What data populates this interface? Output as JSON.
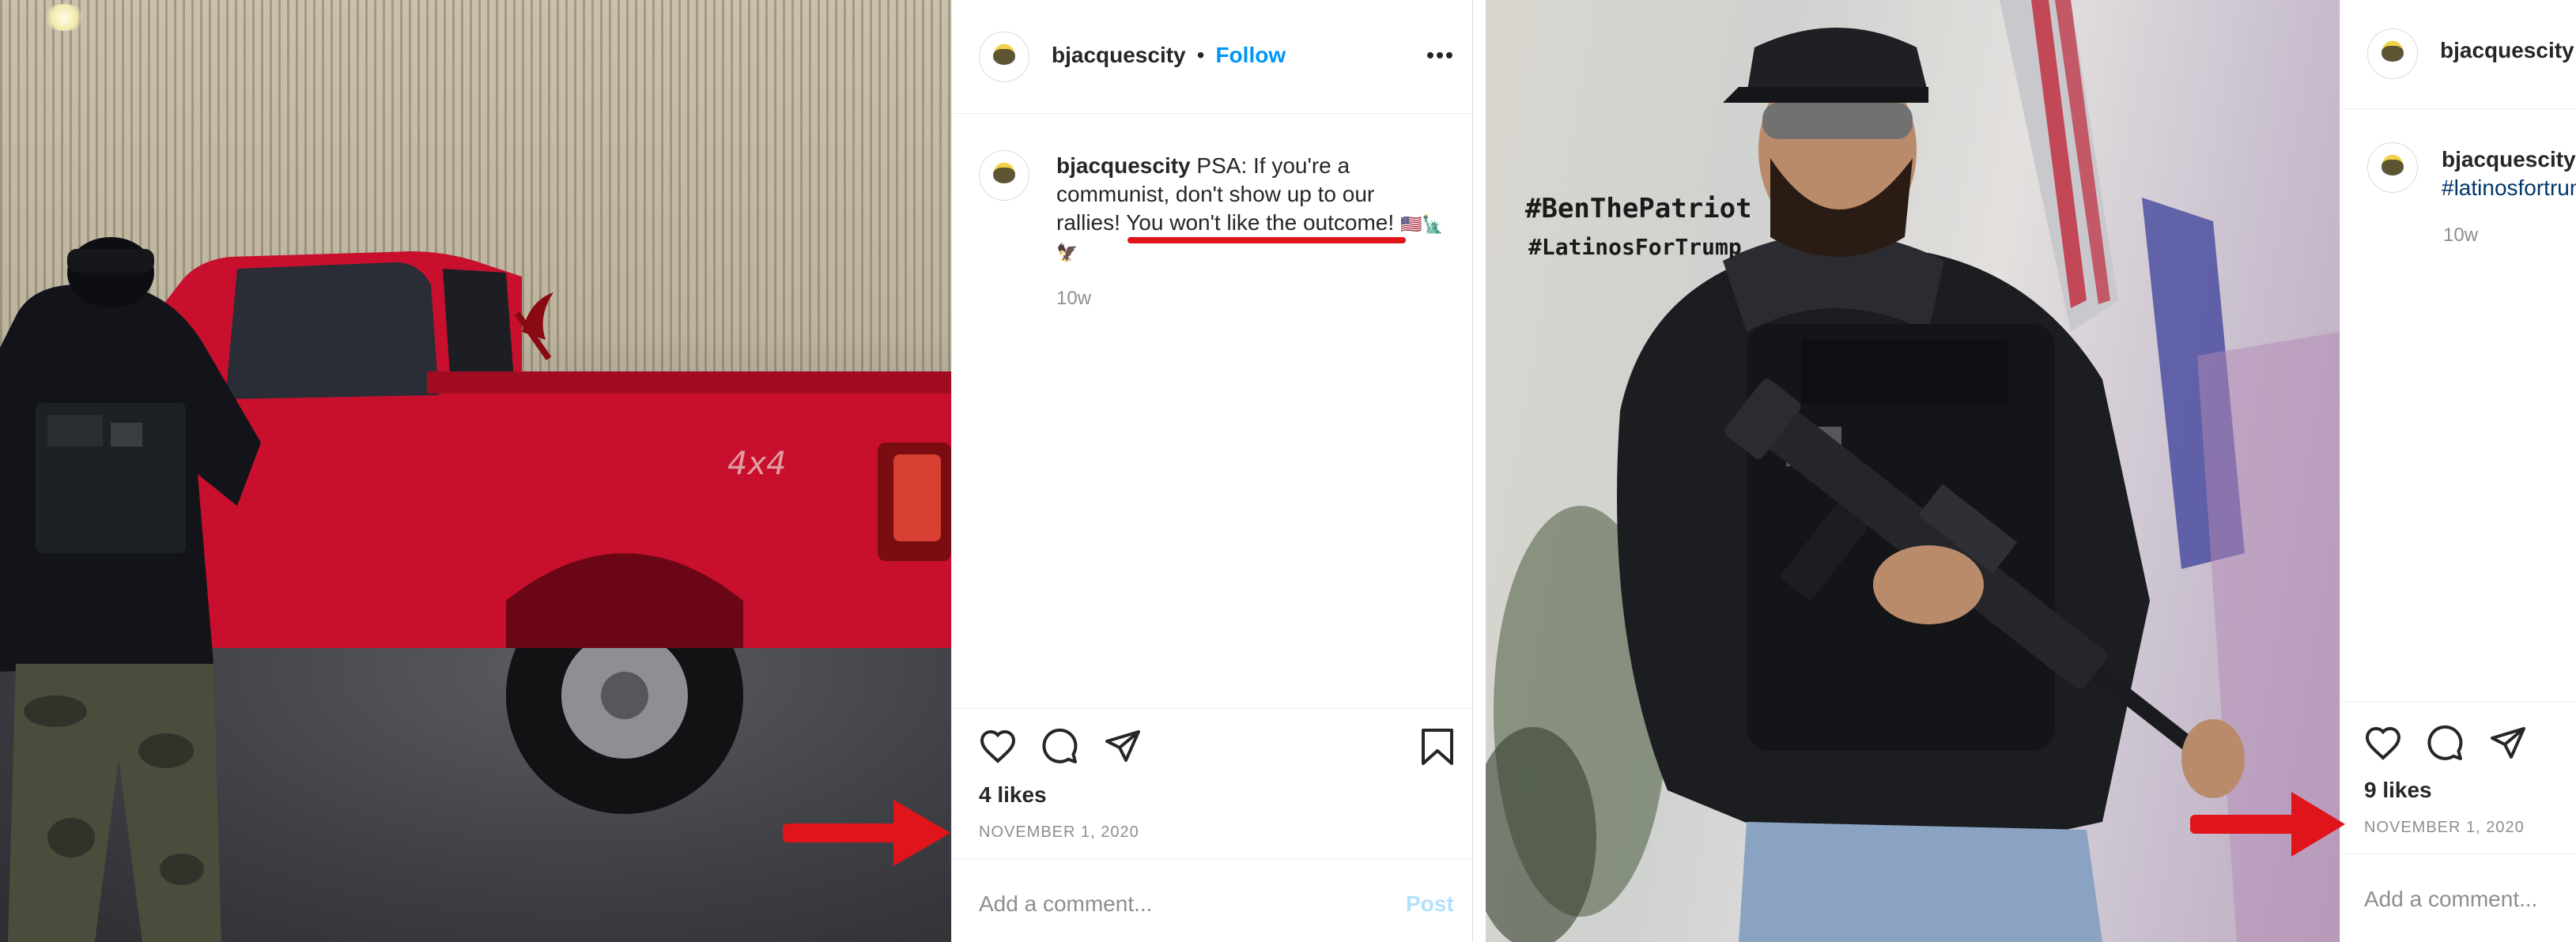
{
  "post1": {
    "username": "bjacquescity",
    "separator": "•",
    "follow_label": "Follow",
    "more_icon": "more-horizontal-icon",
    "caption_username": "bjacquescity",
    "caption_line1": "PSA: If you're a",
    "caption_line2": "communist, don't show up to our",
    "caption_line3_prefix": "rallies! ",
    "caption_highlight": "You won't like the outcome!",
    "caption_emojis": "🇺🇸🗽",
    "caption_line4": "🦅",
    "time_ago": "10w",
    "likes": "4 likes",
    "date": "November 1, 2020",
    "comment_placeholder": "Add a comment...",
    "post_label": "Post",
    "icons": [
      "heart-icon",
      "comment-icon",
      "share-icon",
      "bookmark-icon"
    ]
  },
  "post2": {
    "username": "bjacquescity",
    "caption_username": "bjacquescity",
    "caption_hashtag": "#latinosfortrump",
    "time_ago": "10w",
    "likes": "9 likes",
    "date": "November 1, 2020",
    "comment_placeholder": "Add a comment...",
    "image_overlay_line1": "#BenThePatriot",
    "image_overlay_line2": "#LatinosForTrump",
    "icons": [
      "heart-icon",
      "comment-icon",
      "share-icon"
    ]
  },
  "annotation_colors": {
    "arrow": "#e0141b",
    "underline": "#e0141b",
    "truck": "#c8102e"
  }
}
